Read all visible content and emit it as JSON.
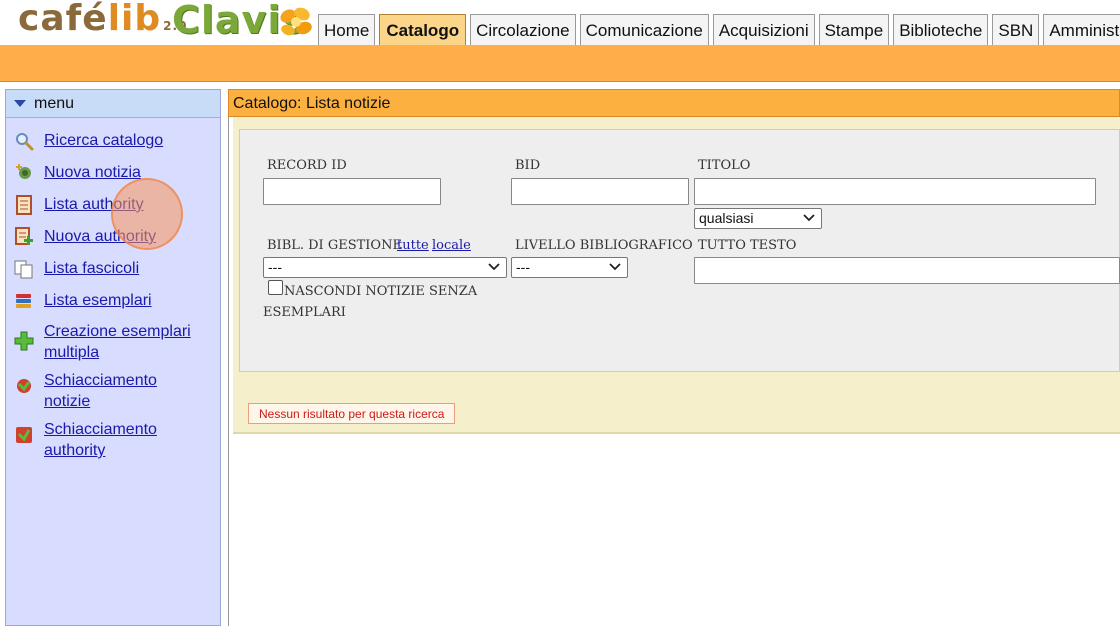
{
  "logo": {
    "cafelib_main": "café",
    "cafelib_lib": "lib",
    "cafelib_version": "2.0",
    "clavis": "Clavis"
  },
  "tabs": [
    {
      "label": "Home",
      "active": false
    },
    {
      "label": "Catalogo",
      "active": true
    },
    {
      "label": "Circolazione",
      "active": false
    },
    {
      "label": "Comunicazione",
      "active": false
    },
    {
      "label": "Acquisizioni",
      "active": false
    },
    {
      "label": "Stampe",
      "active": false
    },
    {
      "label": "Biblioteche",
      "active": false
    },
    {
      "label": "SBN",
      "active": false
    },
    {
      "label": "Amministra",
      "active": false
    }
  ],
  "sidebar": {
    "title": "menu",
    "items": [
      {
        "label": "Ricerca catalogo",
        "icon": "magnifier-icon"
      },
      {
        "label": "Nuova notizia",
        "icon": "new-record-icon"
      },
      {
        "label": "Lista authority",
        "icon": "list-icon"
      },
      {
        "label": "Nuova authority",
        "icon": "new-authority-icon"
      },
      {
        "label": "Lista fascicoli",
        "icon": "copies-icon"
      },
      {
        "label": "Lista esemplari",
        "icon": "books-icon"
      },
      {
        "label": "Creazione esemplari multipla",
        "icon": "plus-icon"
      },
      {
        "label": "Schiacciamento notizie",
        "icon": "merge-icon"
      },
      {
        "label": "Schiacciamento authority",
        "icon": "merge-authority-icon"
      }
    ]
  },
  "main": {
    "title": "Catalogo: Lista notizie",
    "form": {
      "record_id_label": "RECORD ID",
      "record_id_value": "",
      "bid_label": "BID",
      "bid_value": "",
      "titolo_label": "TITOLO",
      "titolo_value": "",
      "titolo_mode": "qualsiasi",
      "bibl_label": "BIBL. DI GESTIONE",
      "bibl_link_tutte": "tutte",
      "bibl_link_locale": "locale",
      "bibl_value": "---",
      "livello_label": "LIVELLO BIBLIOGRAFICO",
      "livello_value": "---",
      "tutto_testo_label": "TUTTO TESTO",
      "tutto_testo_value": "",
      "nascondi_label_line1": "NASCONDI NOTIZIE SENZA",
      "nascondi_label_line2": "ESEMPLARI",
      "nascondi_checked": false
    },
    "no_result": "Nessun risultato per questa ricerca"
  },
  "colors": {
    "orange_bar": "#ffae4a",
    "title_bar": "#fbb040",
    "sidebar_bg": "#d8dcff",
    "link": "#1a1aaa",
    "error_text": "#cc1a1a"
  }
}
